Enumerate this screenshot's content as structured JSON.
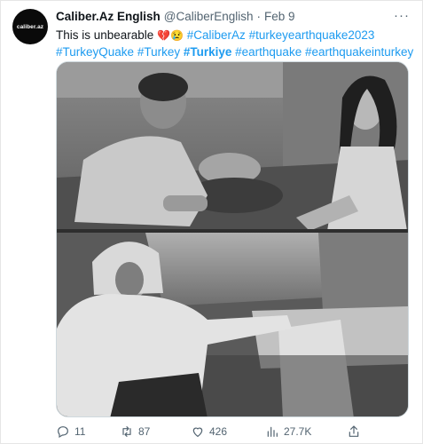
{
  "tweet": {
    "author_name": "Caliber.Az English",
    "handle": "@CaliberEnglish",
    "separator": "·",
    "date": "Feb 9",
    "avatar_text": "caliber.az",
    "more_label": "···",
    "text_intro": "This is unbearable",
    "emoji_1": "💔",
    "emoji_2": "😢",
    "hashtags_line1": [
      "#CaliberAz",
      "#turkeyearthquake2023"
    ],
    "hashtags_line2": [
      "#TurkeyQuake",
      "#Turkey",
      "#Turkiye",
      "#earthquake",
      "#earthquakeinturkey"
    ]
  },
  "actions": {
    "reply_icon": "reply-icon",
    "reply_count": "11",
    "retweet_icon": "retweet-icon",
    "retweet_count": "87",
    "like_icon": "like-icon",
    "like_count": "426",
    "views_icon": "views-icon",
    "views_count": "27.7K",
    "share_icon": "share-icon"
  },
  "colors": {
    "link": "#1d9bf0",
    "secondary_text": "#536471",
    "primary_text": "#0f1419"
  }
}
